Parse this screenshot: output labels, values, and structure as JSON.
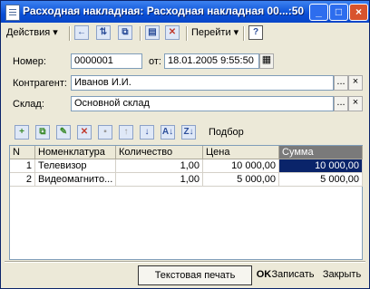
{
  "window": {
    "title": "Расходная накладная: Расходная накладная 00...:50",
    "controls": {
      "minimize": "_",
      "maximize": "□",
      "close": "×"
    }
  },
  "toolbar": {
    "actions_label": "Действия",
    "goto_label": "Перейти",
    "help_label": "?"
  },
  "form": {
    "number_label": "Номер:",
    "number_value": "0000001",
    "date_label": "от:",
    "date_value": "18.01.2005  9:55:50",
    "contractor_label": "Контрагент:",
    "contractor_value": "Иванов И.И.",
    "warehouse_label": "Склад:",
    "warehouse_value": "Основной склад",
    "ellipsis": "...",
    "clear": "×"
  },
  "table_toolbar": {
    "selection_label": "Подбор"
  },
  "table": {
    "columns": [
      "N",
      "Номенклатура",
      "Количество",
      "Цена",
      "Сумма"
    ],
    "rows": [
      {
        "n": "1",
        "item": "Телевизор",
        "qty": "1,00",
        "price": "10 000,00",
        "sum": "10 000,00"
      },
      {
        "n": "2",
        "item": "Видеомагнито...",
        "qty": "1,00",
        "price": "5 000,00",
        "sum": "5 000,00"
      }
    ]
  },
  "footer": {
    "print": "Текстовая печать",
    "ok": "OK",
    "save": "Записать",
    "close": "Закрыть"
  }
}
